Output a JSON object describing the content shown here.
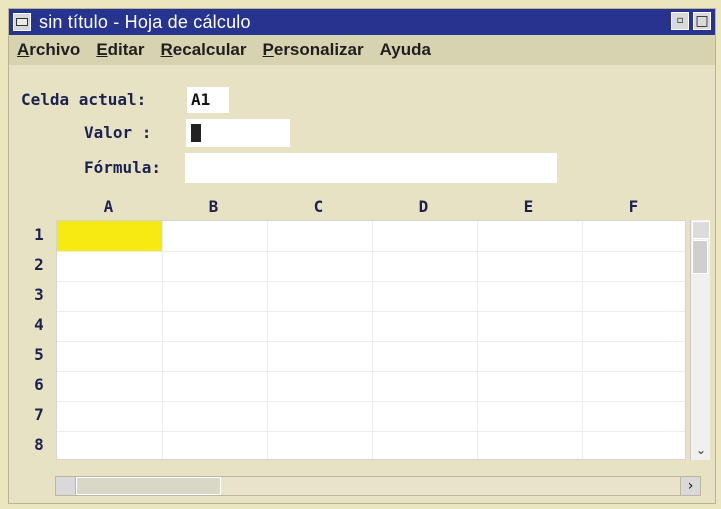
{
  "window": {
    "title": "sin título - Hoja de cálculo",
    "controls": {
      "minimize_glyph": "▫",
      "maximize_glyph": "□"
    },
    "system_icon": "window-system-icon"
  },
  "menu": {
    "items": [
      {
        "label": "Archivo",
        "accesskey": "A"
      },
      {
        "label": "Editar",
        "accesskey": "E"
      },
      {
        "label": "Recalcular",
        "accesskey": "R"
      },
      {
        "label": "Personalizar",
        "accesskey": "P"
      },
      {
        "label": "Ayuda",
        "accesskey": ""
      }
    ]
  },
  "fields": {
    "cell_label": "Celda actual:",
    "cell_value": "A1",
    "value_label": "Valor :",
    "formula_label": "Fórmula:",
    "formula_value": ""
  },
  "grid": {
    "columns": [
      "A",
      "B",
      "C",
      "D",
      "E",
      "F"
    ],
    "rows": [
      "1",
      "2",
      "3",
      "4",
      "5",
      "6",
      "7",
      "8"
    ],
    "active_cell": "A1",
    "active_color": "#f6ea12"
  },
  "scroll": {
    "down_glyph": "⌄",
    "right_glyph": "›"
  }
}
